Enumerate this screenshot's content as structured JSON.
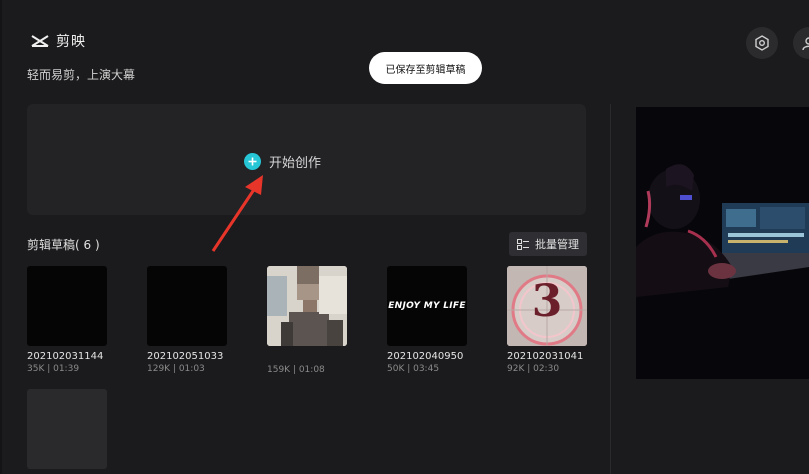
{
  "header": {
    "app_name": "剪映",
    "slogan": "轻而易剪，上演大幕"
  },
  "toast": {
    "text": "已保存至剪辑草稿"
  },
  "create": {
    "label": "开始创作"
  },
  "drafts": {
    "title": "剪辑草稿( 6 )",
    "batch_label": "批量管理",
    "items": [
      {
        "name": "202102031144",
        "meta": "35K | 01:39"
      },
      {
        "name": "202102051033",
        "meta": "129K | 01:03"
      },
      {
        "name": "",
        "meta": "159K | 01:08"
      },
      {
        "name": "202102040950",
        "meta": "50K | 03:45",
        "thumb_text": "ENJOY MY LIFE"
      },
      {
        "name": "202102031041",
        "meta": "92K | 02:30",
        "thumb_text": "3"
      },
      {
        "name": "",
        "meta": ""
      }
    ]
  },
  "colors": {
    "accent": "#26c6d6",
    "background": "#1b1b1d",
    "arrow": "#e8352a"
  },
  "icons": [
    "capcut-logo-icon",
    "settings-icon",
    "user-icon",
    "plus-icon",
    "batch-manage-icon",
    "annotation-arrow"
  ]
}
